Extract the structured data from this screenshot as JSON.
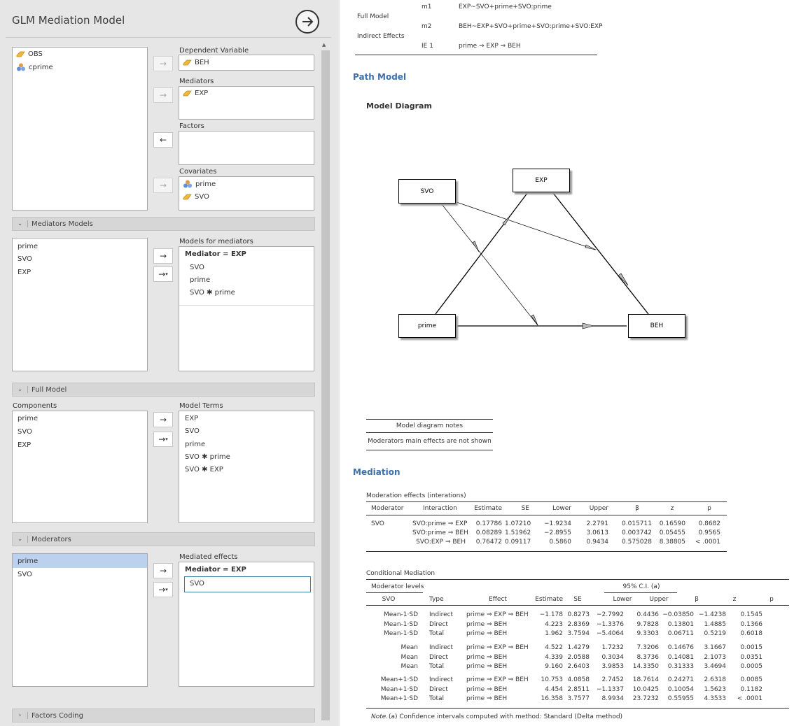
{
  "panel": {
    "title": "GLM Mediation Model"
  },
  "variables": {
    "items": [
      {
        "name": "OBS",
        "icon": "ordinal-icon"
      },
      {
        "name": "cprime",
        "icon": "nominal-icon"
      }
    ]
  },
  "dependent": {
    "label": "Dependent Variable",
    "value": "BEH"
  },
  "mediators": {
    "label": "Mediators",
    "value": "EXP"
  },
  "factors": {
    "label": "Factors"
  },
  "covariates": {
    "label": "Covariates",
    "items": [
      "prime",
      "SVO"
    ]
  },
  "mediators_models": {
    "section": "Mediators Models",
    "available": [
      "prime",
      "SVO",
      "EXP"
    ],
    "models_label": "Models for mediators",
    "model_header": "Mediator = EXP",
    "model_terms": [
      "SVO",
      "prime",
      "SVO ✱ prime"
    ]
  },
  "full_model": {
    "section": "Full Model",
    "components_label": "Components",
    "components": [
      "prime",
      "SVO",
      "EXP"
    ],
    "terms_label": "Model Terms",
    "terms": [
      "EXP",
      "SVO",
      "prime",
      "SVO ✱ prime",
      "SVO ✱ EXP"
    ]
  },
  "moderators": {
    "section": "Moderators",
    "available": [
      "prime",
      "SVO"
    ],
    "mediated_label": "Mediated effects",
    "mediated_header": "Mediator = EXP",
    "mediated_value": "SVO"
  },
  "factors_coding": {
    "section": "Factors Coding"
  },
  "output": {
    "top": {
      "full_model": "Full Model",
      "indirect_effects": "Indirect Effects",
      "rows": [
        {
          "code": "m1",
          "formula": "EXP~SVO+prime+SVO:prime"
        },
        {
          "code": "m2",
          "formula": "BEH~EXP+SVO+prime+SVO:prime+SVO:EXP"
        },
        {
          "code": "IE 1",
          "formula": "prime ⇒ EXP ⇒ BEH"
        }
      ]
    },
    "path_model": {
      "heading": "Path Model",
      "subheading": "Model Diagram",
      "nodes": {
        "svo": "SVO",
        "exp": "EXP",
        "prime": "prime",
        "beh": "BEH"
      },
      "notes_title": "Model diagram notes",
      "notes_text": "Moderators main effects are not shown"
    },
    "mediation": {
      "heading": "Mediation",
      "moderation": {
        "title": "Moderation effects (interations)",
        "columns": [
          "Moderator",
          "Interaction",
          "Estimate",
          "SE",
          "Lower",
          "Upper",
          "β",
          "z",
          "p"
        ],
        "moderator": "SVO",
        "rows": [
          [
            "SVO:prime ⇒ EXP",
            "0.17786",
            "1.07210",
            "−1.9234",
            "2.2791",
            "0.015711",
            "0.16590",
            "0.8682"
          ],
          [
            "SVO:prime ⇒ BEH",
            "0.08289",
            "1.51962",
            "−2.8955",
            "3.0613",
            "0.003742",
            "0.05455",
            "0.9565"
          ],
          [
            "SVO:EXP ⇒ BEH",
            "0.76472",
            "0.09117",
            "0.5860",
            "0.9434",
            "0.575028",
            "8.38805",
            "< .0001"
          ]
        ]
      },
      "conditional": {
        "title": "Conditional Mediation",
        "moderator_levels": "Moderator levels",
        "ci": "95% C.I. (a)",
        "columns": [
          "SVO",
          "Type",
          "Effect",
          "Estimate",
          "SE",
          "Lower",
          "Upper",
          "β",
          "z",
          "p"
        ],
        "groups": [
          [
            [
              "Mean-1·SD",
              "Indirect",
              "prime ⇒ EXP ⇒ BEH",
              "−1.178",
              "0.8273",
              "−2.7992",
              "0.4436",
              "−0.03850",
              "−1.4238",
              "0.1545"
            ],
            [
              "Mean-1·SD",
              "Direct",
              "prime ⇒ BEH",
              "4.223",
              "2.8369",
              "−1.3376",
              "9.7828",
              "0.13801",
              "1.4885",
              "0.1366"
            ],
            [
              "Mean-1·SD",
              "Total",
              "prime ⇒ BEH",
              "1.962",
              "3.7594",
              "−5.4064",
              "9.3303",
              "0.06711",
              "0.5219",
              "0.6018"
            ]
          ],
          [
            [
              "Mean",
              "Indirect",
              "prime ⇒ EXP ⇒ BEH",
              "4.522",
              "1.4279",
              "1.7232",
              "7.3206",
              "0.14676",
              "3.1667",
              "0.0015"
            ],
            [
              "Mean",
              "Direct",
              "prime ⇒ BEH",
              "4.339",
              "2.0588",
              "0.3034",
              "8.3736",
              "0.14081",
              "2.1073",
              "0.0351"
            ],
            [
              "Mean",
              "Total",
              "prime ⇒ BEH",
              "9.160",
              "2.6403",
              "3.9853",
              "14.3350",
              "0.31333",
              "3.4694",
              "0.0005"
            ]
          ],
          [
            [
              "Mean+1·SD",
              "Indirect",
              "prime ⇒ EXP ⇒ BEH",
              "10.753",
              "4.0858",
              "2.7452",
              "18.7614",
              "0.24271",
              "2.6318",
              "0.0085"
            ],
            [
              "Mean+1·SD",
              "Direct",
              "prime ⇒ BEH",
              "4.454",
              "2.8511",
              "−1.1337",
              "10.0425",
              "0.10054",
              "1.5623",
              "0.1182"
            ],
            [
              "Mean+1·SD",
              "Total",
              "prime ⇒ BEH",
              "16.358",
              "3.7577",
              "8.9934",
              "23.7232",
              "0.55955",
              "4.3533",
              "< .0001"
            ]
          ]
        ],
        "note_label": "Note.",
        "note_text": "(a) Confidence intervals computed with method: Standard (Delta method)"
      }
    }
  },
  "colors": {
    "heading": "#3e6fa8",
    "selected": "#bcd1ee",
    "ordinal": "#f0b83c",
    "nominal_a": "#e39a48",
    "nominal_b": "#5f8fd8"
  }
}
